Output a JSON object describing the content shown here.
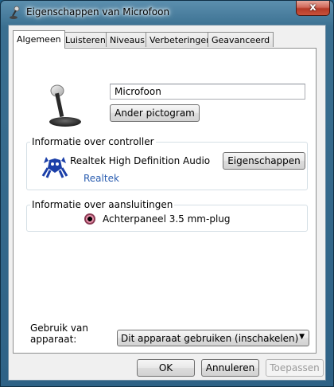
{
  "window": {
    "title": "Eigenschappen van Microfoon",
    "close_glyph": "x"
  },
  "tabs": [
    {
      "label": "Algemeen",
      "active": true
    },
    {
      "label": "Luisteren",
      "active": false
    },
    {
      "label": "Niveaus",
      "active": false
    },
    {
      "label": "Verbeteringen",
      "active": false
    },
    {
      "label": "Geavanceerd",
      "active": false
    }
  ],
  "general": {
    "device_icon": "microphone-icon",
    "name_value": "Microfoon",
    "change_icon_label": "Ander pictogram"
  },
  "controller": {
    "group_label": "Informatie over controller",
    "icon": "realtek-crab-icon",
    "device_name": "Realtek High Definition Audio",
    "vendor_link": "Realtek",
    "properties_label": "Eigenschappen"
  },
  "connections": {
    "group_label": "Informatie over aansluitingen",
    "jack_color": "#e58fa8",
    "jack_label": "Achterpaneel 3.5 mm-plug"
  },
  "usage": {
    "label": "Gebruik van apparaat:",
    "selected": "Dit apparaat gebruiken (inschakelen)"
  },
  "footer": {
    "ok_label": "OK",
    "cancel_label": "Annuleren",
    "apply_label": "Toepassen",
    "apply_enabled": false
  },
  "colors": {
    "link": "#2a5db0",
    "glass_frame": "#3a6f90",
    "close_button": "#c8513b"
  }
}
